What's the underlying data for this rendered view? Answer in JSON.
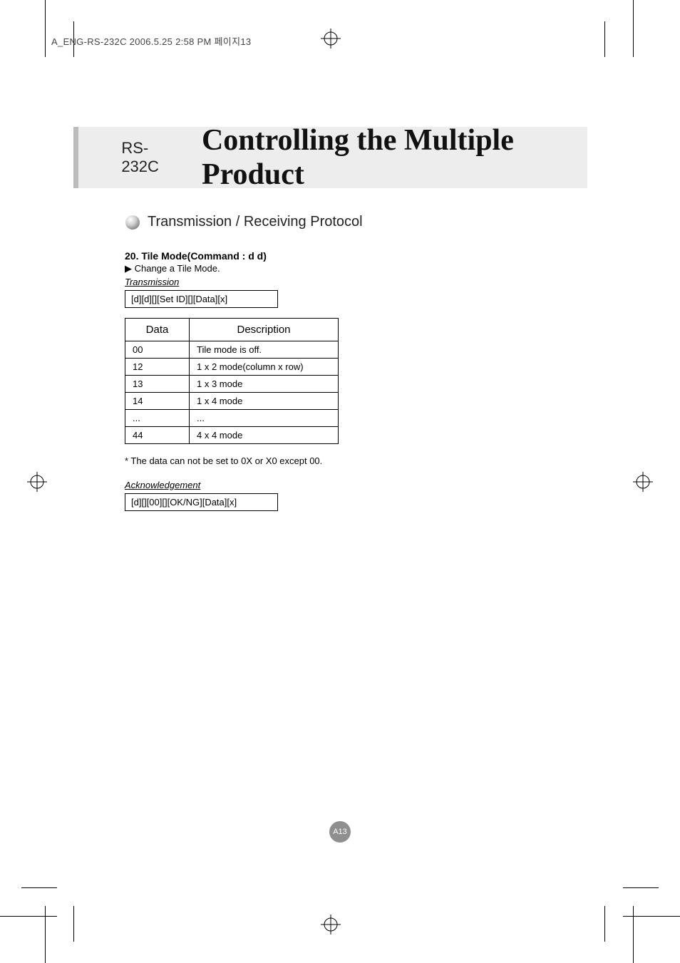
{
  "file_header": "A_ENG-RS-232C  2006.5.25  2:58 PM  페이지13",
  "banner": {
    "prefix": "RS-232C",
    "title": "Controlling the Multiple Product"
  },
  "section_heading": "Transmission / Receiving Protocol",
  "command": {
    "title": "20. Tile Mode(Command : d d)",
    "desc_prefix": "▶",
    "desc": "Change a Tile Mode.",
    "transmission_label": "Transmission",
    "transmission_syntax": "[d][d][][Set ID][][Data][x]"
  },
  "table": {
    "headers": {
      "col1": "Data",
      "col2": "Description"
    },
    "rows": [
      {
        "data": "00",
        "desc": "Tile mode is off."
      },
      {
        "data": "12",
        "desc": "1 x 2 mode(column x row)"
      },
      {
        "data": "13",
        "desc": "1 x 3 mode"
      },
      {
        "data": "14",
        "desc": "1 x 4 mode"
      },
      {
        "data": "...",
        "desc": "..."
      },
      {
        "data": "44",
        "desc": "4 x 4 mode"
      }
    ]
  },
  "footnote": "* The data can not be set to 0X or X0 except 00.",
  "ack": {
    "label": "Acknowledgement",
    "syntax": "[d][][00][][OK/NG][Data][x]"
  },
  "page_number": "A13"
}
